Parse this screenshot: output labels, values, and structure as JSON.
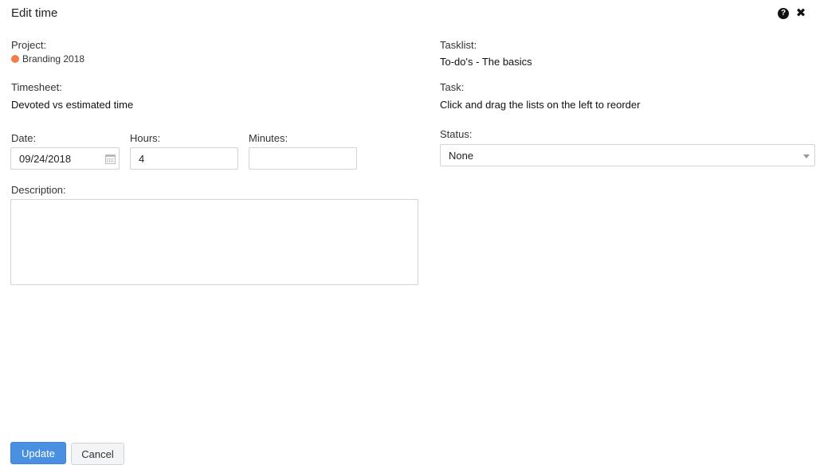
{
  "dialog": {
    "title": "Edit time"
  },
  "project": {
    "label": "Project:",
    "name": "Branding 2018",
    "color": "#f47c48"
  },
  "timesheet": {
    "label": "Timesheet:",
    "value": "Devoted vs estimated time"
  },
  "tasklist": {
    "label": "Tasklist:",
    "value": "To-do's - The basics"
  },
  "task": {
    "label": "Task:",
    "value": "Click and drag the lists on the left to reorder"
  },
  "date": {
    "label": "Date:",
    "value": "09/24/2018"
  },
  "hours": {
    "label": "Hours:",
    "value": "4"
  },
  "minutes": {
    "label": "Minutes:",
    "value": ""
  },
  "status": {
    "label": "Status:",
    "value": "None"
  },
  "description": {
    "label": "Description:",
    "value": ""
  },
  "actions": {
    "update_label": "Update",
    "cancel_label": "Cancel"
  },
  "colors": {
    "primary": "#4a90e2"
  }
}
